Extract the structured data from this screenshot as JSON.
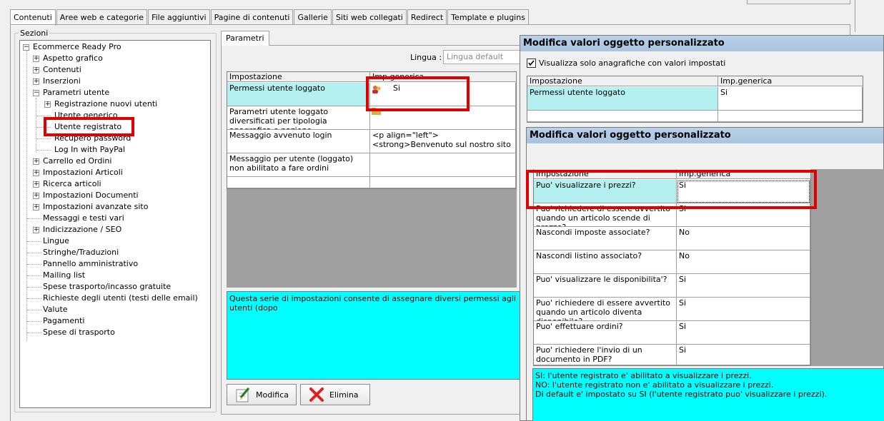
{
  "tabs": [
    "Contenuti",
    "Aree web e categorie",
    "File aggiuntivi",
    "Pagine di contenuti",
    "Gallerie",
    "Siti web collegati",
    "Redirect",
    "Template e plugins"
  ],
  "sections_label": "Sezioni",
  "tree": [
    {
      "label": "Ecommerce Ready Pro",
      "expander": "−"
    },
    {
      "label": "Aspetto grafico",
      "expander": "+"
    },
    {
      "label": "Contenuti",
      "expander": "+"
    },
    {
      "label": "Inserzioni",
      "expander": "+"
    },
    {
      "label": "Parametri utente",
      "expander": "−"
    },
    {
      "label": "Registrazione nuovi utenti",
      "expander": "+"
    },
    {
      "label": "Utente generico",
      "expander": ""
    },
    {
      "label": "Utente registrato",
      "expander": ""
    },
    {
      "label": "Recupero password",
      "expander": ""
    },
    {
      "label": "Log In with PayPal",
      "expander": ""
    },
    {
      "label": "Carrello ed Ordini",
      "expander": "+"
    },
    {
      "label": "Impostazioni Articoli",
      "expander": "+"
    },
    {
      "label": "Ricerca articoli",
      "expander": "+"
    },
    {
      "label": "Impostazioni Documenti",
      "expander": "+"
    },
    {
      "label": "Impostazioni avanzate sito",
      "expander": "+"
    },
    {
      "label": "Messaggi e testi vari",
      "expander": ""
    },
    {
      "label": "Indicizzazione / SEO",
      "expander": "+"
    },
    {
      "label": "Lingue",
      "expander": ""
    },
    {
      "label": "Stringhe/Traduzioni",
      "expander": ""
    },
    {
      "label": "Pannello amministrativo",
      "expander": ""
    },
    {
      "label": "Mailing list",
      "expander": ""
    },
    {
      "label": "Spese trasporto/incasso gratuite",
      "expander": ""
    },
    {
      "label": "Richieste degli utenti (testi delle email)",
      "expander": ""
    },
    {
      "label": "Valute",
      "expander": ""
    },
    {
      "label": "Pagamenti",
      "expander": ""
    },
    {
      "label": "Spese di trasporto",
      "expander": ""
    }
  ],
  "params": {
    "tab": "Parametri",
    "lingua_label": "Lingua :",
    "lingua_value": "Lingua default",
    "col1": "Impostazione",
    "col2": "Imp.generica",
    "rows": [
      {
        "name": "Permessi utente loggato",
        "value": "Si"
      },
      {
        "name": "Parametri utente loggato diversificati per tipologia anagrafica e nazione",
        "value": ""
      },
      {
        "name": "Messaggio avvenuto login",
        "value": "<p align=\"left\"><strong>Benvenuto sul nostro sito"
      },
      {
        "name": "Messaggio per utente (loggato) non abilitato a fare ordini",
        "value": ""
      }
    ],
    "description": "Questa serie di impostazioni consente di assegnare diversi permessi agli utenti (dopo",
    "btn_modifica": "Modifica",
    "btn_elimina": "Elimina"
  },
  "dialog1": {
    "title": "Modifica valori oggetto personalizzato",
    "checkbox_label": "Visualizza solo anagrafiche con valori impostati",
    "col1": "Impostazione",
    "col2": "Imp.generica",
    "rows": [
      {
        "name": "Permessi utente loggato",
        "value": "Si"
      }
    ]
  },
  "dialog2": {
    "title": "Modifica valori oggetto personalizzato",
    "col1": "Impostazione",
    "col2": "Imp.generica",
    "rows": [
      {
        "name": "Puo' visualizzare i prezzi?",
        "value": "Si"
      },
      {
        "name": "Puo' richiedere di essere avvertito quando un articolo scende di prezzo?",
        "value": "Si"
      },
      {
        "name": "Nascondi imposte associate?",
        "value": "No"
      },
      {
        "name": "Nascondi listino associato?",
        "value": "No"
      },
      {
        "name": "Puo' visualizzare le disponibilita'?",
        "value": "Si"
      },
      {
        "name": "Puo' richiedere di essere avvertito quando un articolo diventa disponibile?",
        "value": "Si"
      },
      {
        "name": "Puo' effettuare ordini?",
        "value": "Si"
      },
      {
        "name": "Puo' richiedere l'invio di un documento in PDF?",
        "value": "Si"
      }
    ],
    "description": [
      "SI: l'utente registrato e' abilitato a visualizzare i prezzi.",
      "NO: l'utente registrato non e' abilitato a visualizzare i prezzi.",
      "Di default e' impostato su SI (l'utente registrato puo' visualizzare i prezzi)."
    ]
  },
  "colors": {
    "highlight_red": "#e00000",
    "selected_row": "#b4f0f0",
    "description_bg": "#00ffff"
  }
}
